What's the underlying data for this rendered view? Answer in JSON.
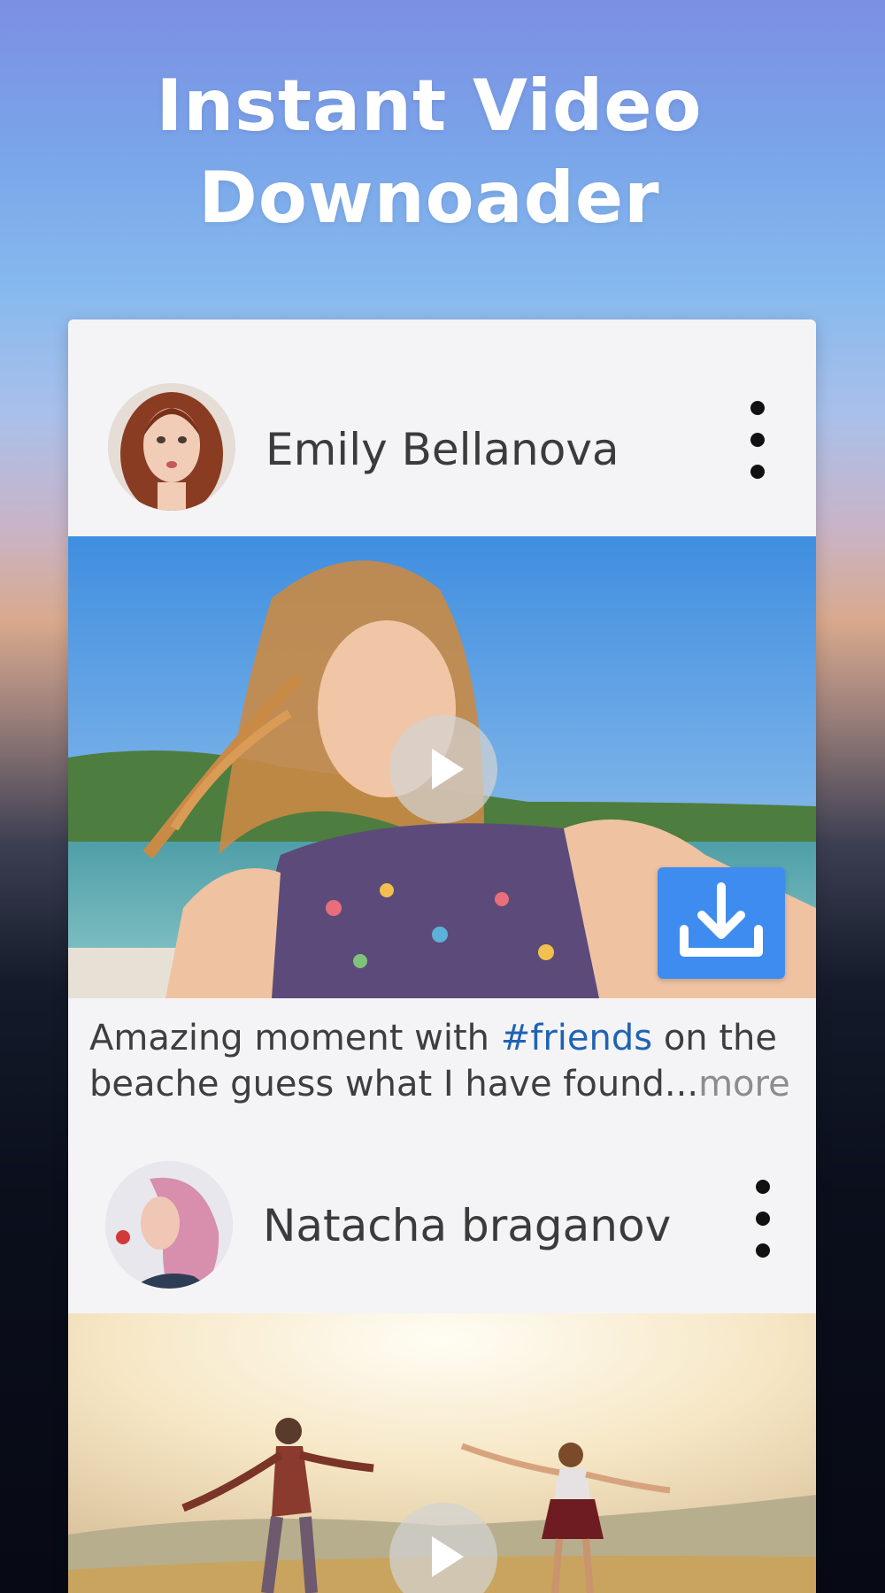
{
  "header": {
    "title_line1": "Instant Video",
    "title_line2": "Downoader"
  },
  "posts": [
    {
      "user_name": "Emily Bellanova",
      "caption_before": "Amazing moment with ",
      "caption_hashtag": "#friends",
      "caption_after": " on the beache guess what I have found...",
      "caption_more": "more"
    },
    {
      "user_name": "Natacha braganov"
    }
  ],
  "icons": {
    "more": "more-vertical-icon",
    "play": "play-icon",
    "download": "download-icon"
  },
  "colors": {
    "download_button": "#3f8cf1",
    "hashtag": "#1f63b3",
    "more_link": "#8c8c8c"
  }
}
